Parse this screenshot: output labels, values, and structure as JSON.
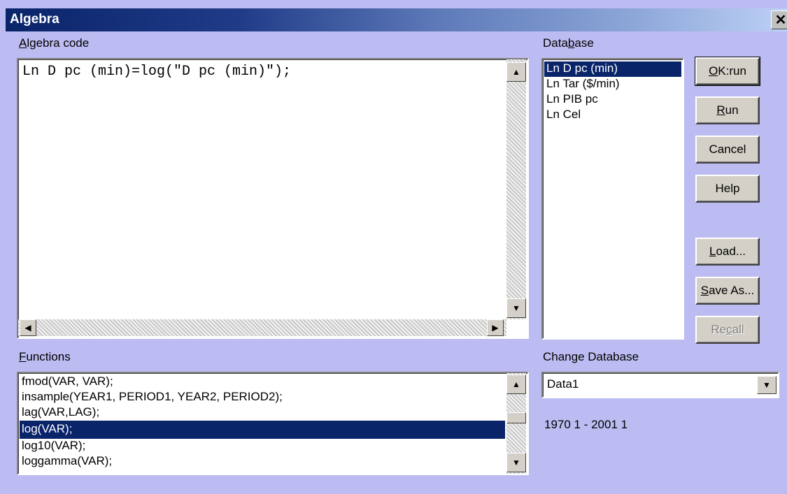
{
  "window": {
    "title": "Algebra",
    "close_glyph": "✕"
  },
  "code_section": {
    "label_prefix": "A",
    "label_rest": "lgebra code",
    "code": "Ln D pc (min)=log(\"D pc (min)\");"
  },
  "database_section": {
    "label_before": "Data",
    "label_underline": "b",
    "label_after": "ase",
    "items": [
      {
        "label": "Ln D pc (min)",
        "selected": true
      },
      {
        "label": "Ln Tar ($/min)",
        "selected": false
      },
      {
        "label": "Ln PIB pc",
        "selected": false
      },
      {
        "label": "Ln Cel",
        "selected": false
      }
    ]
  },
  "buttons": {
    "ok_u": "O",
    "ok_rest": "K:run",
    "run_u": "R",
    "run_rest": "un",
    "cancel": "Cancel",
    "help": "Help",
    "load_u": "L",
    "load_rest": "oad...",
    "saveas_u": "S",
    "saveas_rest": "ave As...",
    "recall_a": "Re",
    "recall_u": "c",
    "recall_b": "all"
  },
  "functions_section": {
    "label_u": "F",
    "label_rest": "unctions",
    "items": [
      {
        "label": "fmod(VAR, VAR);",
        "selected": false
      },
      {
        "label": "insample(YEAR1, PERIOD1, YEAR2, PERIOD2);",
        "selected": false
      },
      {
        "label": "lag(VAR,LAG);",
        "selected": false
      },
      {
        "label": "log(VAR);",
        "selected": true
      },
      {
        "label": "log10(VAR);",
        "selected": false
      },
      {
        "label": "loggamma(VAR);",
        "selected": false
      }
    ]
  },
  "change_database": {
    "label": "Change Database",
    "selected": "Data1",
    "range": "1970 1 - 2001 1"
  },
  "icons": {
    "up_arrow": "▲",
    "down_arrow": "▼",
    "left_arrow": "◀",
    "right_arrow": "▶"
  }
}
